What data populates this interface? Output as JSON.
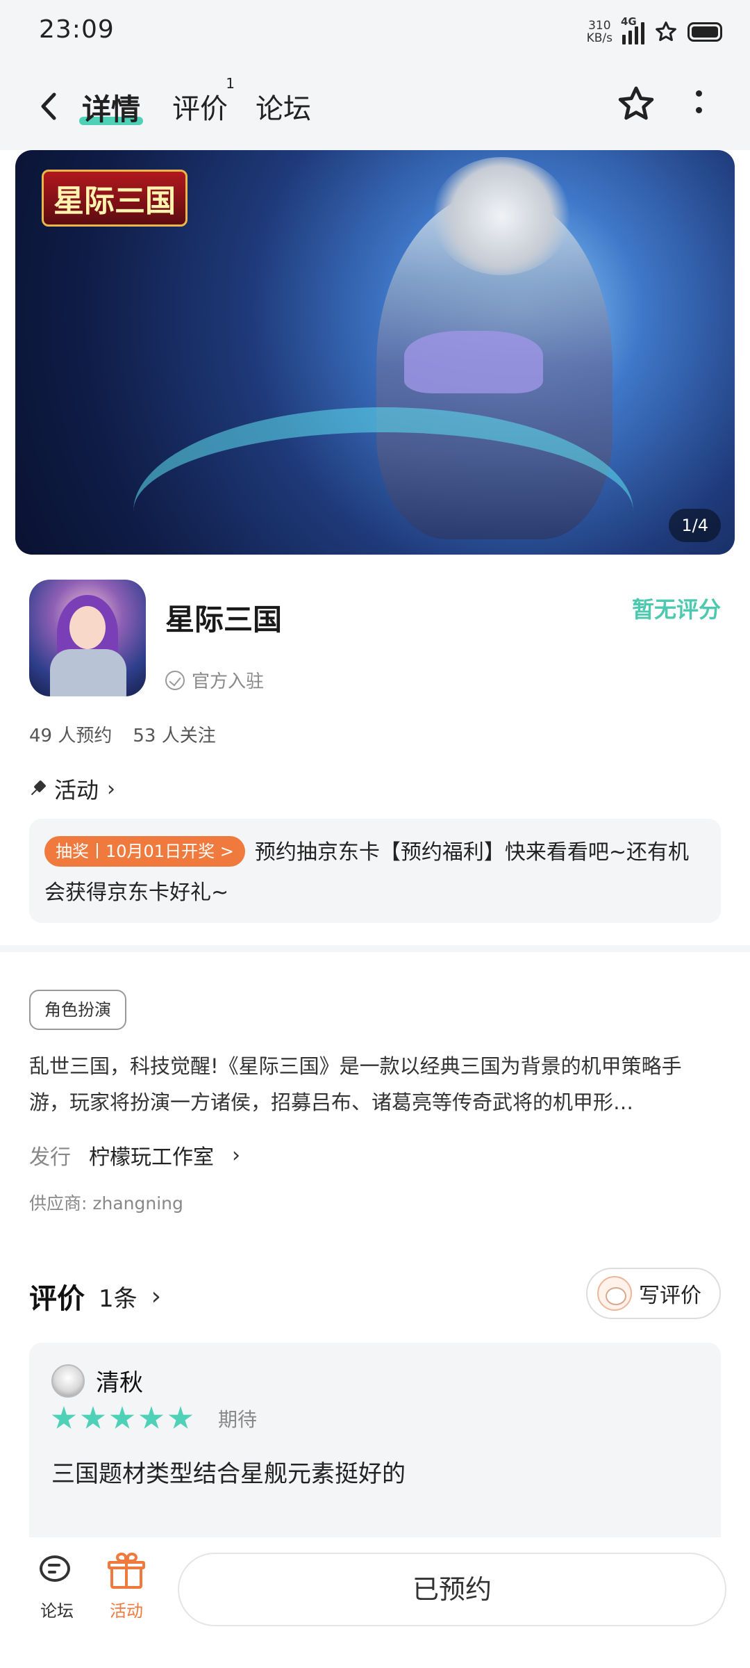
{
  "status_bar": {
    "time": "23:09",
    "net_speed_value": "310",
    "net_speed_unit": "KB/s",
    "network": "4G",
    "icons": [
      "signal-icon",
      "star-notification-icon",
      "battery-icon"
    ]
  },
  "header": {
    "tabs": [
      {
        "label": "详情",
        "active": true
      },
      {
        "label": "评价",
        "badge": "1"
      },
      {
        "label": "论坛"
      }
    ],
    "accent_color": "#4fd1b8"
  },
  "banner": {
    "logo_text": "星际三国",
    "page_indicator": "1/4"
  },
  "app": {
    "name": "星际三国",
    "official_label": "官方入驻",
    "rating_label": "暂无评分",
    "reservations": "49 人预约",
    "followers": "53 人关注"
  },
  "activity": {
    "title": "活动",
    "tag": "抽奖丨10月01日开奖 >",
    "text": "预约抽京东卡【预约福利】快来看看吧~还有机会获得京东卡好礼~"
  },
  "details": {
    "genre_tag": "角色扮演",
    "description": "乱世三国，科技觉醒!《星际三国》是一款以经典三国为背景的机甲策略手游，玩家将扮演一方诸侯，招募吕布、诸葛亮等传奇武将的机甲形…",
    "publisher_label": "发行",
    "publisher_name": "柠檬玩工作室",
    "supplier": "供应商: zhangning"
  },
  "reviews": {
    "title": "评价",
    "count": "1条",
    "write_label": "写评价",
    "items": [
      {
        "user": "清秋",
        "stars": 5,
        "status": "期待",
        "text": "三国题材类型结合星舰元素挺好的"
      }
    ]
  },
  "bottom_bar": {
    "forum_label": "论坛",
    "activity_label": "活动",
    "reserve_label": "已预约",
    "activity_color": "#f07a3e"
  }
}
